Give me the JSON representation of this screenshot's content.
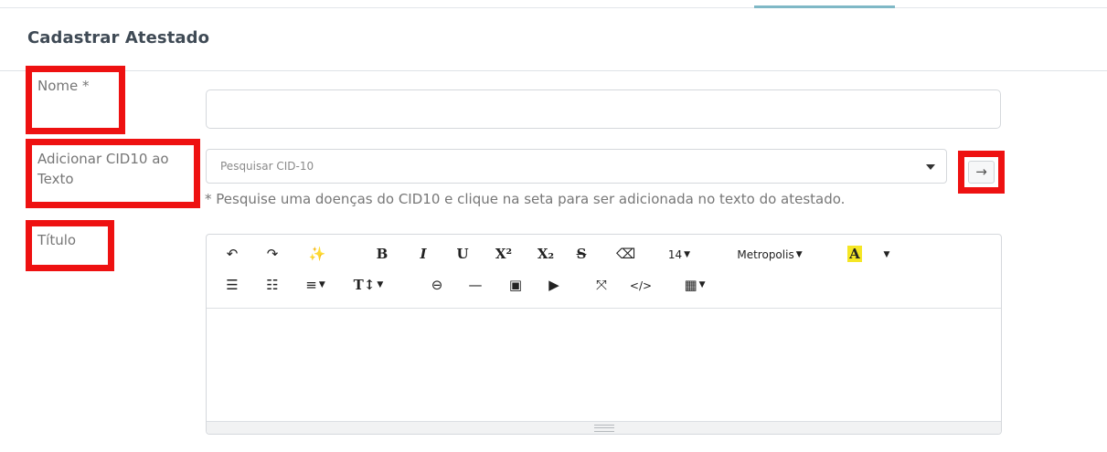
{
  "page": {
    "title": "Cadastrar Atestado"
  },
  "form": {
    "nome": {
      "label": "Nome *",
      "value": "",
      "placeholder": ""
    },
    "cid": {
      "label": "Adicionar CID10 ao Texto",
      "placeholder": "Pesquisar CID-10",
      "add_button_glyph": "→",
      "help": "* Pesquise uma doenças do CID10 e clique na seta para ser adicionada no texto do atestado."
    },
    "titulo": {
      "label": "Título"
    }
  },
  "editor": {
    "toolbar": {
      "undo": "↶",
      "redo": "↷",
      "magic": "✨",
      "bold": "B",
      "italic": "I",
      "underline": "U",
      "superscript": "X²",
      "subscript": "X₂",
      "strikethrough": "S",
      "eraser": "⌫",
      "font_size": "14",
      "font_family": "Metropolis",
      "highlight": "A",
      "unordered_list": "☰",
      "ordered_list": "☷",
      "align": "≡",
      "text_style": "T↕",
      "link": "⊖",
      "hr": "—",
      "image": "▣",
      "video": "▶",
      "fullscreen": "⤧",
      "code": "</>",
      "table": "▦"
    },
    "content": ""
  },
  "colors": {
    "highlight_red": "#ee1111",
    "tab_accent": "#7fb8c6",
    "marker_yellow": "#f5e625"
  }
}
